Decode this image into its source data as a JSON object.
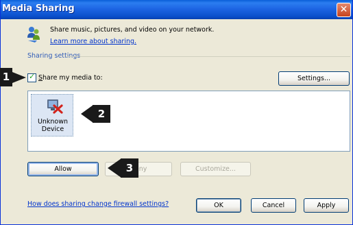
{
  "window": {
    "title": "Media Sharing",
    "close_glyph": "✕"
  },
  "intro": {
    "text": "Share music, pictures, and video on your network.",
    "learn_more": "Learn more about sharing."
  },
  "sharing_settings": {
    "group_label": "Sharing settings",
    "share_checkbox_prefix": "S",
    "share_checkbox_rest": "hare my media to:",
    "share_checked": true,
    "settings_button": "Settings..."
  },
  "devices": [
    {
      "name_line1": "Unknown",
      "name_line2": "Device",
      "icon": "unknown-device-icon"
    }
  ],
  "device_actions": {
    "allow": "Allow",
    "deny": "Deny",
    "customize": "Customize..."
  },
  "footer": {
    "firewall_link": "How does sharing change firewall settings?",
    "ok": "OK",
    "cancel": "Cancel",
    "apply": "Apply"
  },
  "callouts": {
    "one": "1",
    "two": "2",
    "three": "3"
  },
  "colors": {
    "title_bar": "#1E66E4",
    "dialog_bg": "#ECE9D8",
    "link": "#0033CC",
    "callout": "#1A1A1A"
  }
}
